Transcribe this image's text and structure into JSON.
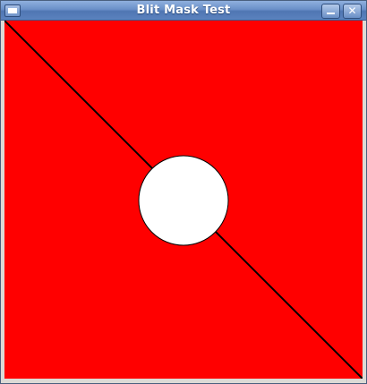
{
  "window": {
    "title": "Blit Mask Test"
  },
  "icons": {
    "window_menu": "window-menu-icon",
    "minimize": "minimize-icon",
    "close": "close-icon"
  },
  "canvas": {
    "background_color": "#ff0000",
    "line_color": "#000000",
    "circle_fill": "#ffffff",
    "circle_stroke": "#000000"
  }
}
